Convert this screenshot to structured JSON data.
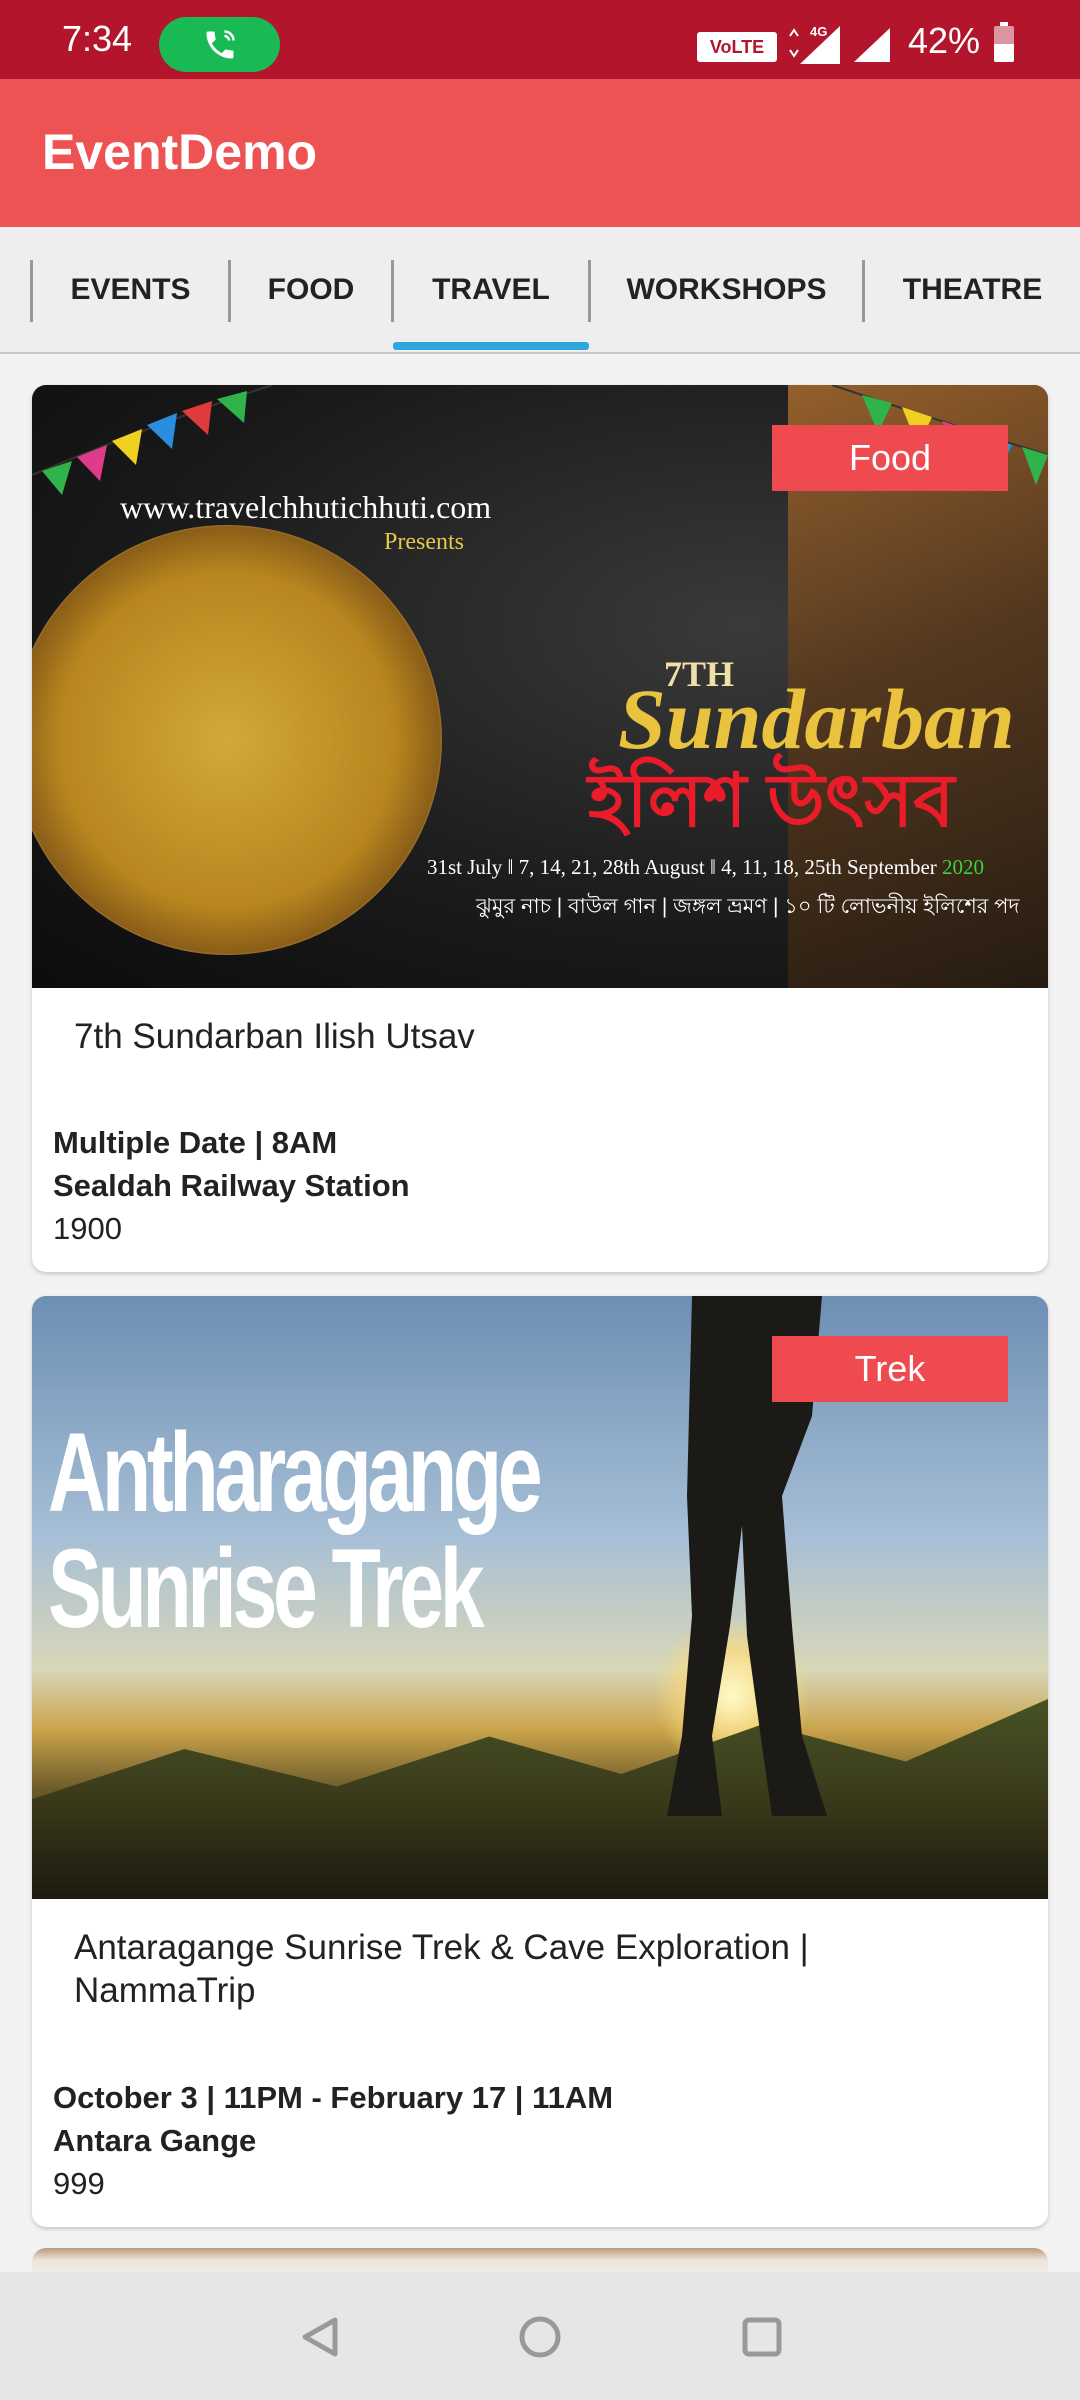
{
  "status_bar": {
    "time": "7:34",
    "volte": "VoLTE",
    "network": "4G",
    "battery": "42%",
    "battery_level": 0.42,
    "icons": [
      "phone-call-icon",
      "signal-4g-icon",
      "signal-icon",
      "battery-icon"
    ]
  },
  "app_bar": {
    "title": "EventDemo"
  },
  "tabs": [
    {
      "label": "EVENTS"
    },
    {
      "label": "FOOD"
    },
    {
      "label": "TRAVEL",
      "selected": true
    },
    {
      "label": "WORKSHOPS"
    },
    {
      "label": "THEATRE"
    }
  ],
  "cards": [
    {
      "category": "Food",
      "title": "7th Sundarban Ilish Utsav",
      "date": "Multiple Date | 8AM",
      "venue": "Sealdah Railway Station",
      "price": "1900",
      "image_text": {
        "url": "www.travelchhutichhuti.com",
        "presents": "Presents",
        "edition": "7TH",
        "name": "Sundarban",
        "bengali_title": "ইলিশ উৎসব",
        "dates": "31st July  ‖  7, 14, 21, 28th August  ‖  4, 11, 18, 25th September",
        "year": "2020",
        "bengali_sub": "ঝুমুর নাচ | বাউল গান | জঙ্গল ভ্রমণ | ১০ টি লোভনীয় ইলিশের পদ"
      }
    },
    {
      "category": "Trek",
      "title": "Antaragange Sunrise Trek & Cave Exploration | NammaTrip",
      "date": "October 3 | 11PM - February 17 | 11AM",
      "venue": "Antara Gange",
      "price": "999",
      "image_text": {
        "line1": "Antharagange",
        "line2": "Sunrise Trek"
      }
    }
  ],
  "nav_bar": {
    "icons": [
      "back-icon",
      "home-icon",
      "recents-icon"
    ]
  },
  "colors": {
    "status_bar": "#b3152c",
    "app_bar": "#ee5353",
    "badge": "#ef4a50",
    "tab_indicator": "#2fa6de",
    "call_pill": "#19b954"
  }
}
